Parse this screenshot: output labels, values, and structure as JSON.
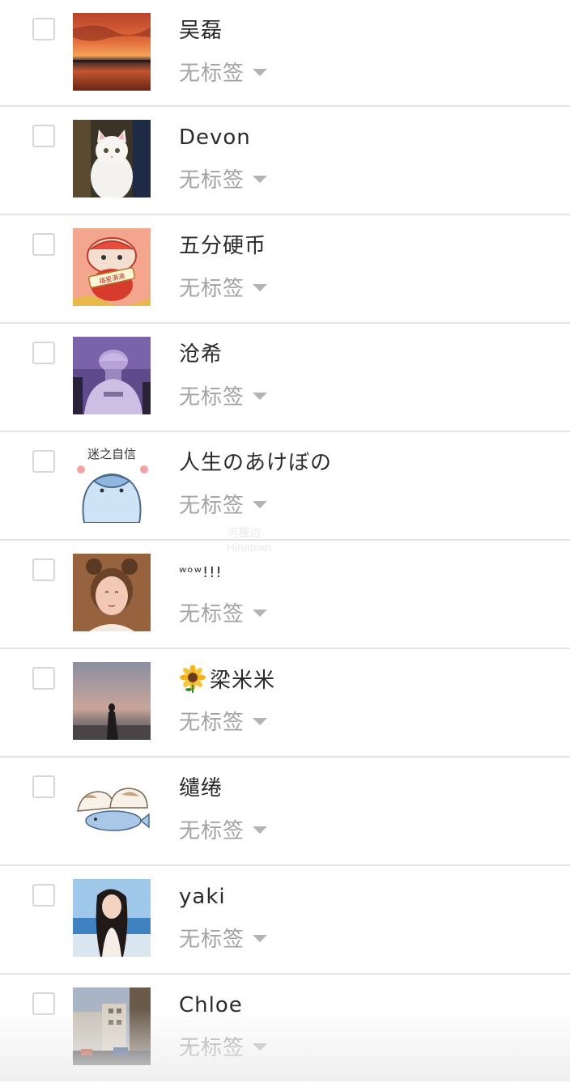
{
  "contacts": [
    {
      "name": "吴磊",
      "tag": "无标签",
      "avatar": "sunset-sea-avatar"
    },
    {
      "name": "Devon",
      "tag": "无标签",
      "avatar": "white-cat-avatar"
    },
    {
      "name": "五分硬币",
      "tag": "无标签",
      "avatar": "lion-dance-cartoon-avatar",
      "avatar_text": "福星满满"
    },
    {
      "name": "沧希",
      "tag": "无标签",
      "avatar": "purple-cap-person-avatar"
    },
    {
      "name": "人生のあけぼの",
      "tag": "无标签",
      "avatar": "cartoon-dolphin-avatar",
      "avatar_text": "迷之自信"
    },
    {
      "name": "ʷᵒʷ!!!",
      "tag": "无标签",
      "avatar": "little-girl-avatar"
    },
    {
      "name": "梁米米",
      "tag": "无标签",
      "avatar": "silhouette-dusk-avatar",
      "name_icon": "sunflower-icon"
    },
    {
      "name": "缱绻",
      "tag": "无标签",
      "avatar": "cartoon-cats-fish-avatar"
    },
    {
      "name": "yaki",
      "tag": "无标签",
      "avatar": "girl-at-beach-avatar"
    },
    {
      "name": "Chloe",
      "tag": "无标签",
      "avatar": "city-street-avatar"
    }
  ],
  "watermark": {
    "line1": "河狸边",
    "line2": "Hinabian"
  },
  "colors": {
    "text": "#2b2b2b",
    "tag_text": "#a3a3a3",
    "divider": "#e4e4e4",
    "checkbox_border": "#d7d7d7"
  }
}
